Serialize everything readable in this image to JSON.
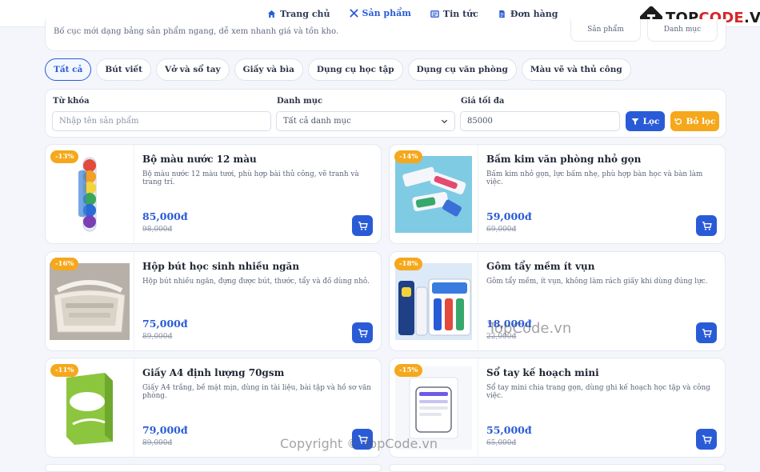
{
  "nav": {
    "items": [
      {
        "label": "Trang chủ",
        "icon": "home-icon"
      },
      {
        "label": "Sản phẩm",
        "icon": "tools-icon",
        "active": true
      },
      {
        "label": "Tin tức",
        "icon": "newspaper-icon"
      },
      {
        "label": "Đơn hàng",
        "icon": "document-icon"
      }
    ]
  },
  "logo": {
    "text_plain": "TOP",
    "text_highlight": "CODE",
    "text_suffix": ".VN"
  },
  "header": {
    "description": "Bố cục mới dạng bảng sản phẩm ngang, dễ xem nhanh giá và tồn kho.",
    "stats": [
      "Sản phẩm",
      "Danh mục"
    ]
  },
  "categories": [
    "Tất cả",
    "Bút viết",
    "Vở và sổ tay",
    "Giấy và bìa",
    "Dụng cụ học tập",
    "Dụng cụ văn phòng",
    "Màu vẽ và thủ công"
  ],
  "active_category": "Tất cả",
  "filter": {
    "keyword_label": "Từ khóa",
    "keyword_placeholder": "Nhập tên sản phẩm",
    "category_label": "Danh mục",
    "category_value": "Tất cả danh mục",
    "max_price_label": "Giá tối đa",
    "max_price_value": "85000",
    "filter_button": "Lọc",
    "reset_button": "Bỏ lọc"
  },
  "products": [
    {
      "badge": "-13%",
      "name": "Bộ màu nước 12 màu",
      "desc": "Bộ màu nước 12 màu tươi, phù hợp bài thủ công, vẽ tranh và trang trí.",
      "price": "85,000đ",
      "old_price": "98,000đ"
    },
    {
      "badge": "-14%",
      "name": "Bấm kim văn phòng nhỏ gọn",
      "desc": "Bấm kim nhỏ gọn, lực bấm nhẹ, phù hợp bàn học và bàn làm việc.",
      "price": "59,000đ",
      "old_price": "69,000đ"
    },
    {
      "badge": "-16%",
      "name": "Hộp bút học sinh nhiều ngăn",
      "desc": "Hộp bút nhiều ngăn, đựng được bút, thước, tẩy và đồ dùng nhỏ.",
      "price": "75,000đ",
      "old_price": "89,000đ"
    },
    {
      "badge": "-18%",
      "name": "Gôm tẩy mềm ít vụn",
      "desc": "Gôm tẩy mềm, ít vụn, không làm rách giấy khi dùng đúng lực.",
      "price": "18,000đ",
      "old_price": "22,000đ"
    },
    {
      "badge": "-11%",
      "name": "Giấy A4 định lượng 70gsm",
      "desc": "Giấy A4 trắng, bề mặt mịn, dùng in tài liệu, bài tập và hồ sơ văn phòng.",
      "price": "79,000đ",
      "old_price": "89,000đ"
    },
    {
      "badge": "-15%",
      "name": "Sổ tay kế hoạch mini",
      "desc": "Sổ tay mini chia trang gọn, dùng ghi kế hoạch học tập và công việc.",
      "price": "55,000đ",
      "old_price": "65,000đ"
    }
  ],
  "watermarks": {
    "center": "TopCode.vn",
    "bottom": "Copyright © TopCode.vn"
  },
  "colors": {
    "primary": "#2a5bd7",
    "accent": "#f5a81c",
    "brand_red": "#d7262a"
  }
}
